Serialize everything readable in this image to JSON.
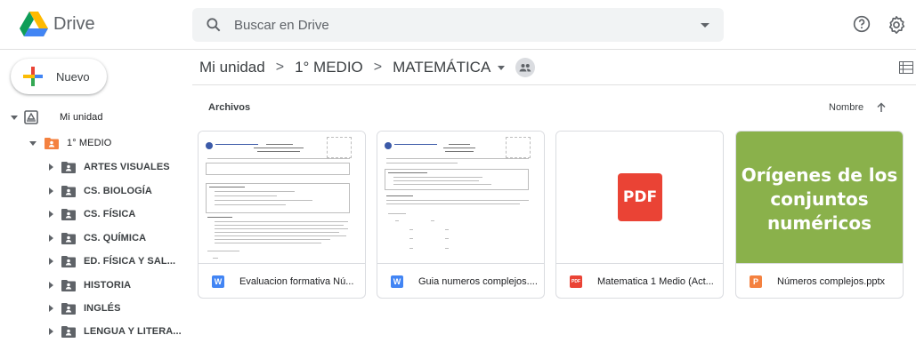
{
  "app": {
    "title": "Drive"
  },
  "search": {
    "placeholder": "Buscar en Drive"
  },
  "new_button": {
    "label": "Nuevo"
  },
  "tree": {
    "root": "Mi unidad",
    "folder": "1° MEDIO",
    "children": [
      "ARTES VISUALES",
      "CS. BIOLOGÍA",
      "CS. FÍSICA",
      "CS. QUÍMICA",
      "ED. FÍSICA Y SAL...",
      "HISTORIA",
      "INGLÉS",
      "LENGUA Y LITERA..."
    ]
  },
  "breadcrumb": {
    "items": [
      "Mi unidad",
      "1° MEDIO",
      "MATEMÁTICA"
    ],
    "separator": ">"
  },
  "section": {
    "title": "Archivos"
  },
  "sort": {
    "label": "Nombre"
  },
  "files": [
    {
      "name": "Evaluacion formativa Nú...",
      "type": "docx",
      "icon_letter": "W",
      "icon_color": "#4285f4"
    },
    {
      "name": "Guia numeros complejos....",
      "type": "docx",
      "icon_letter": "W",
      "icon_color": "#4285f4"
    },
    {
      "name": "Matematica 1 Medio (Act...",
      "type": "pdf",
      "icon_letter": "PDF",
      "icon_color": "#ea4335",
      "thumb_label": "PDF"
    },
    {
      "name": "Números complejos.pptx",
      "type": "pptx",
      "icon_letter": "P",
      "icon_color": "#f4813f",
      "thumb_title": "Orígenes de los conjuntos numéricos"
    }
  ],
  "colors": {
    "folder_orange": "#f4813f",
    "folder_gray": "#5f6368",
    "ppt_green": "#8ab14b"
  }
}
